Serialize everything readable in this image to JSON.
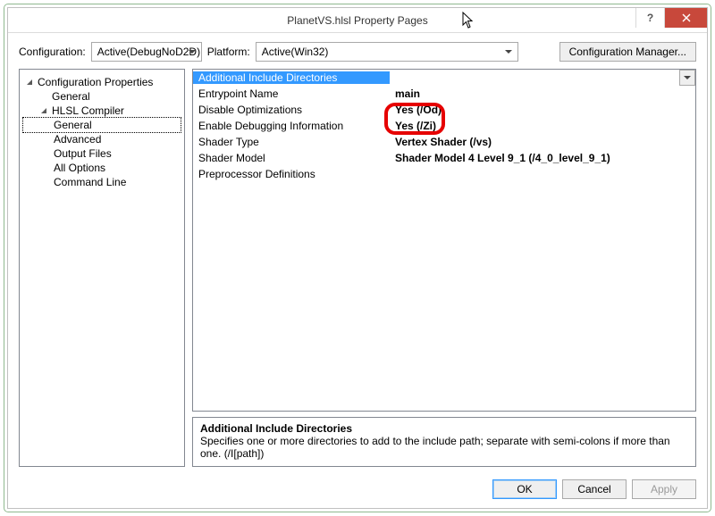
{
  "window": {
    "title": "PlanetVS.hlsl Property Pages"
  },
  "config": {
    "configLabel": "Configuration:",
    "configValue": "Active(DebugNoD2D)",
    "platformLabel": "Platform:",
    "platformValue": "Active(Win32)",
    "managerBtn": "Configuration Manager..."
  },
  "tree": {
    "root": "Configuration Properties",
    "items": [
      {
        "label": "General"
      },
      {
        "label": "HLSL Compiler",
        "expandable": true,
        "children": [
          {
            "label": "General",
            "selected": true
          },
          {
            "label": "Advanced"
          },
          {
            "label": "Output Files"
          },
          {
            "label": "All Options"
          },
          {
            "label": "Command Line"
          }
        ]
      }
    ]
  },
  "grid": {
    "rows": [
      {
        "label": "Additional Include Directories",
        "value": "",
        "selected": true
      },
      {
        "label": "Entrypoint Name",
        "value": "main"
      },
      {
        "label": "Disable Optimizations",
        "value": "Yes (/Od)"
      },
      {
        "label": "Enable Debugging Information",
        "value": "Yes (/Zi)",
        "highlighted": true
      },
      {
        "label": "Shader Type",
        "value": "Vertex Shader (/vs)"
      },
      {
        "label": "Shader Model",
        "value": "Shader Model 4 Level 9_1 (/4_0_level_9_1)"
      },
      {
        "label": "Preprocessor Definitions",
        "value": ""
      }
    ]
  },
  "desc": {
    "title": "Additional Include Directories",
    "text": "Specifies one or more directories to add to the include path; separate with semi-colons if more than one. (/I[path])"
  },
  "buttons": {
    "ok": "OK",
    "cancel": "Cancel",
    "apply": "Apply"
  }
}
